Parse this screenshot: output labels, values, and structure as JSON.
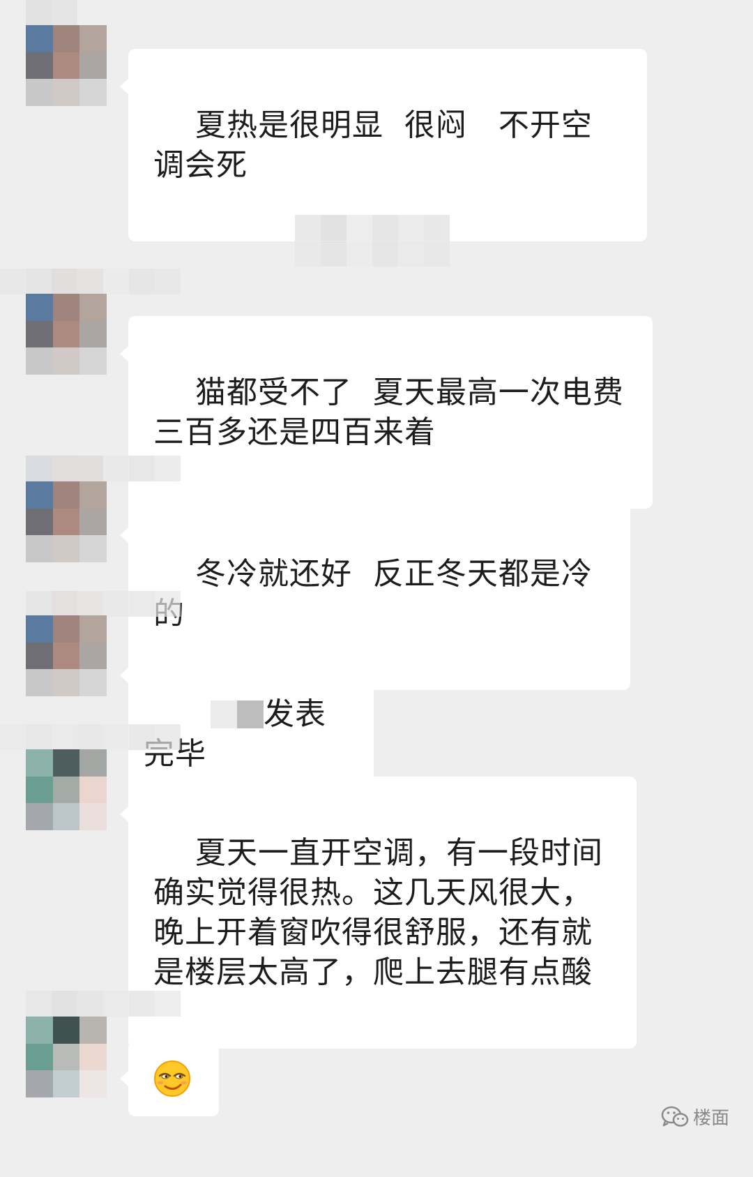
{
  "messages": [
    {
      "text": "夏热是很明显  很闷   不开空调会死"
    },
    {
      "text": "猫都受不了  夏天最高一次电费三百多还是四百来着"
    },
    {
      "text": "冬冷就还好  反正冬天都是冷的"
    },
    {
      "text": "发表完毕"
    },
    {
      "text": "夏天一直开空调，有一段时间确实觉得很热。这几天风很大，晚上开着窗吹得很舒服，还有就是楼层太高了，爬上去腿有点酸"
    },
    {
      "emoji": "smirk-emoji"
    }
  ],
  "watermark": {
    "icon": "wechat-icon",
    "text": "楼面"
  },
  "colors": {
    "background": "#eeeeee",
    "bubble": "#ffffff",
    "text": "#1c1c1c",
    "watermark": "#8a8a8a"
  }
}
